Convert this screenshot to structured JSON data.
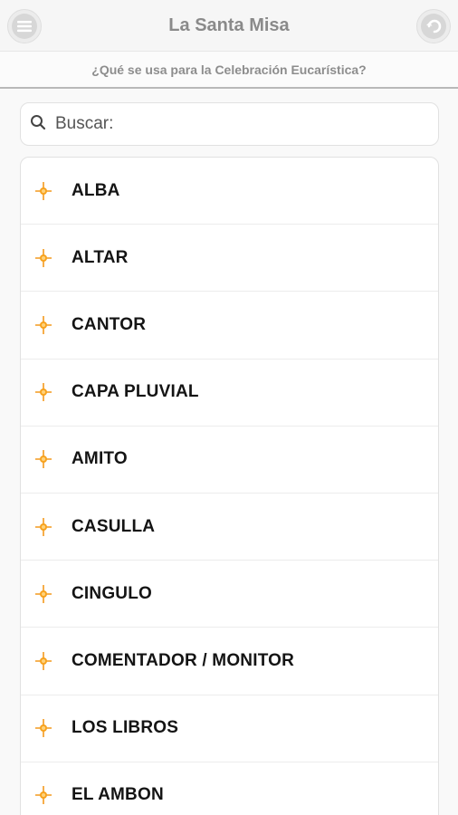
{
  "header": {
    "title": "La Santa Misa",
    "menu_icon": "menu-icon",
    "back_icon": "back-arrow-icon"
  },
  "subheader": {
    "text": "¿Qué se usa para la Celebración Eucarística?"
  },
  "search": {
    "icon": "search-icon",
    "label": "Buscar:"
  },
  "colors": {
    "accent": "#f39a1e",
    "title": "#8a8a8a",
    "item_text": "#141414"
  },
  "list": {
    "item_icon": "sparkle-icon",
    "items": [
      {
        "label": "ALBA"
      },
      {
        "label": "ALTAR"
      },
      {
        "label": "CANTOR"
      },
      {
        "label": "CAPA PLUVIAL"
      },
      {
        "label": "AMITO"
      },
      {
        "label": "CASULLA"
      },
      {
        "label": "CINGULO"
      },
      {
        "label": "COMENTADOR / MONITOR"
      },
      {
        "label": "LOS LIBROS"
      },
      {
        "label": "EL AMBON"
      }
    ]
  }
}
